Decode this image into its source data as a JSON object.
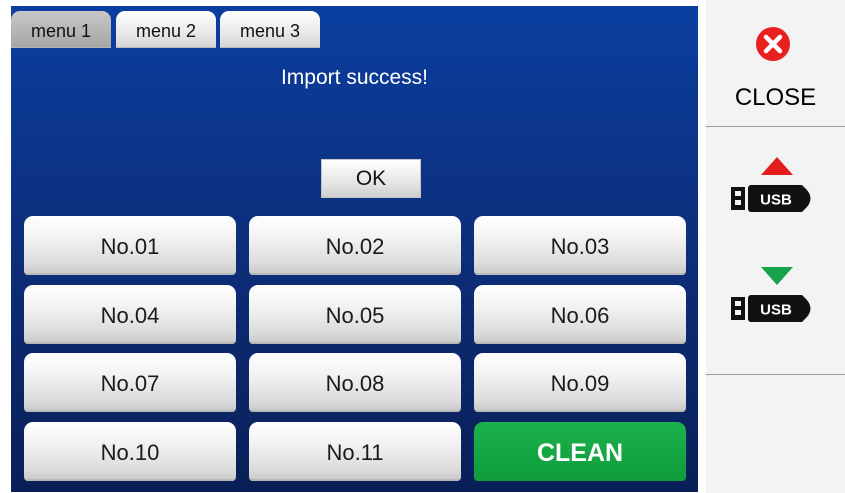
{
  "tabs": [
    {
      "label": "menu 1",
      "active": true
    },
    {
      "label": "menu 2",
      "active": false
    },
    {
      "label": "menu 3",
      "active": false
    }
  ],
  "message": "Import success!",
  "ok_label": "OK",
  "presets": [
    "No.01",
    "No.02",
    "No.03",
    "No.04",
    "No.05",
    "No.06",
    "No.07",
    "No.08",
    "No.09",
    "No.10",
    "No.11"
  ],
  "clean_label": "CLEAN",
  "side": {
    "close_label": "CLOSE",
    "usb_export_icon": "usb-upload-icon",
    "usb_import_icon": "usb-download-icon",
    "usb_text": "USB"
  },
  "colors": {
    "panel_top": "#0a3fa0",
    "panel_bottom": "#0a1f57",
    "close_red": "#e8201f",
    "clean_green": "#13a545",
    "upload_arrow": "#e31d1d",
    "download_arrow": "#16a34a"
  }
}
